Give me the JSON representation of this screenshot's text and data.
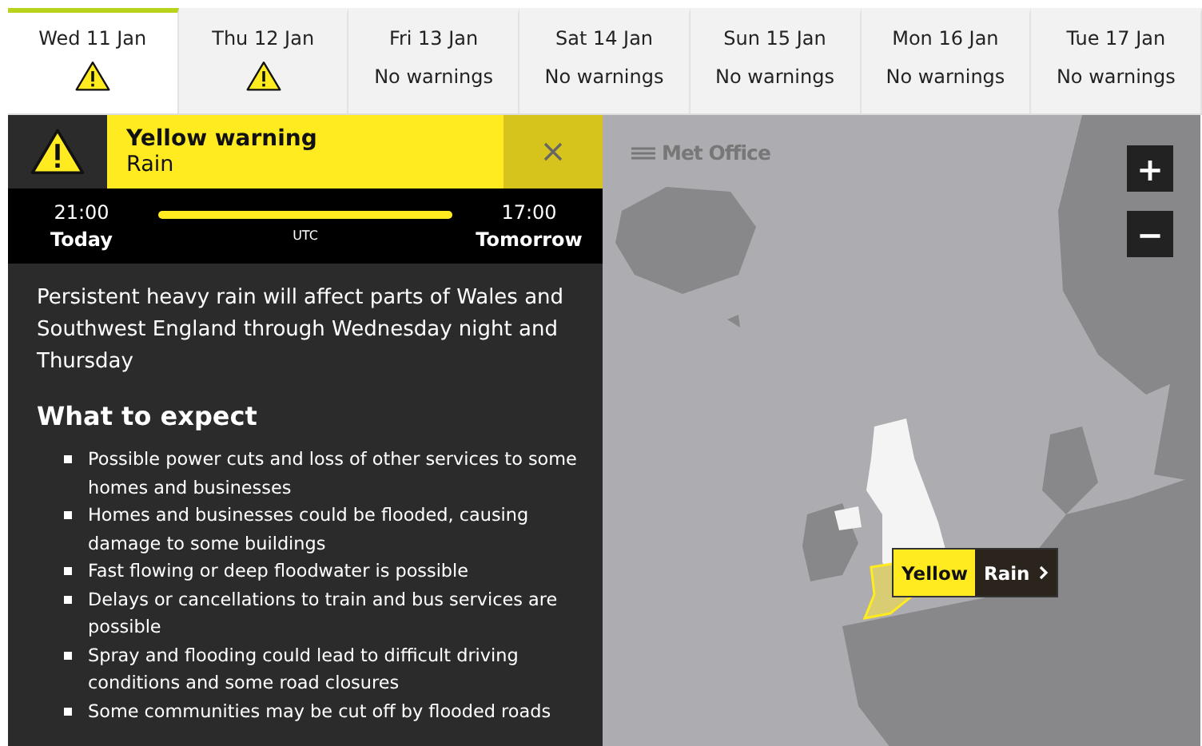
{
  "days": [
    {
      "label": "Wed 11 Jan",
      "selected": true,
      "kind": "warning"
    },
    {
      "label": "Thu 12 Jan",
      "selected": false,
      "kind": "warning"
    },
    {
      "label": "Fri 13 Jan",
      "selected": false,
      "kind": "none",
      "status": "No warnings"
    },
    {
      "label": "Sat 14 Jan",
      "selected": false,
      "kind": "none",
      "status": "No warnings"
    },
    {
      "label": "Sun 15 Jan",
      "selected": false,
      "kind": "none",
      "status": "No warnings"
    },
    {
      "label": "Mon 16 Jan",
      "selected": false,
      "kind": "none",
      "status": "No warnings"
    },
    {
      "label": "Tue 17 Jan",
      "selected": false,
      "kind": "none",
      "status": "No warnings"
    }
  ],
  "warning": {
    "title": "Yellow warning",
    "type": "Rain",
    "color": "#ffeb1f"
  },
  "timeline": {
    "start_time": "21:00",
    "start_day": "Today",
    "zone": "UTC",
    "end_time": "17:00",
    "end_day": "Tomorrow"
  },
  "summary": "Persistent heavy rain will affect parts of Wales and Southwest England through Wednesday night and Thursday",
  "heading": "What to expect",
  "bullets": [
    "Possible power cuts and loss of other services to some homes and businesses",
    "Homes and businesses could be flooded, causing damage to some buildings",
    "Fast flowing or deep floodwater is possible",
    "Delays or cancellations to train and bus services are possible",
    "Spray and flooding could lead to difficult driving conditions and some road closures",
    "Some communities may be cut off by flooded roads"
  ],
  "map": {
    "logo": "Met Office",
    "zoom_in": "+",
    "zoom_out": "−",
    "label": {
      "level": "Yellow",
      "type": "Rain"
    }
  }
}
